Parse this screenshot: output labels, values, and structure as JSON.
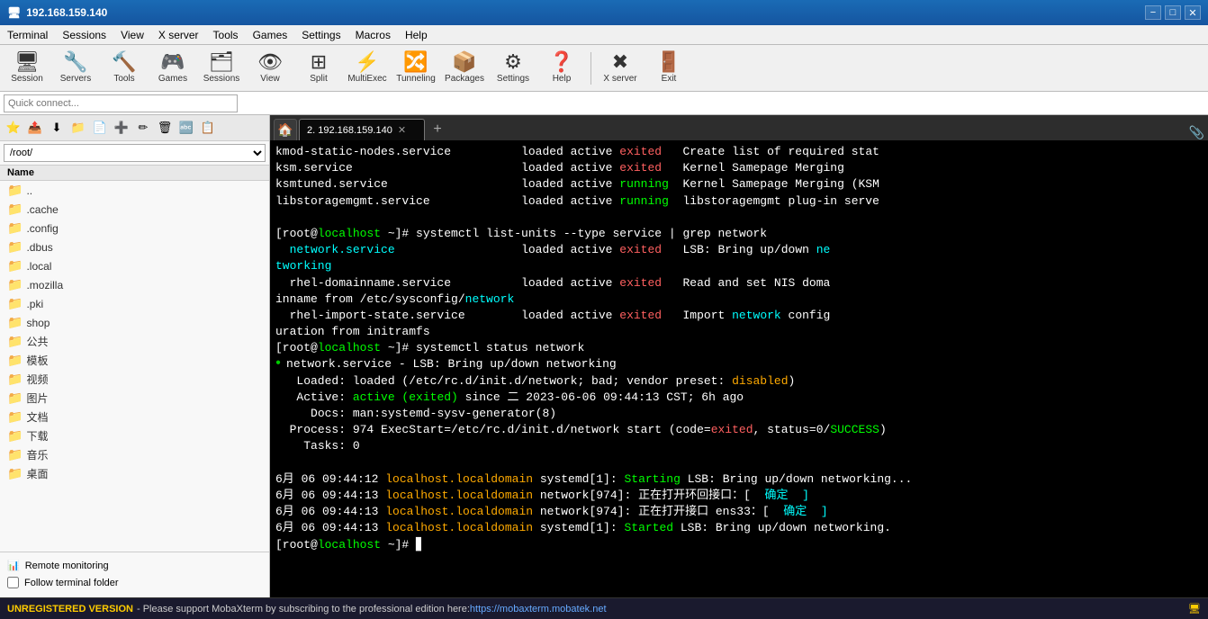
{
  "window": {
    "title": "192.168.159.140",
    "title_icon": "🖥",
    "controls": {
      "minimize": "−",
      "maximize": "□",
      "close": "✕"
    }
  },
  "menu": {
    "items": [
      "Terminal",
      "Sessions",
      "View",
      "X server",
      "Tools",
      "Games",
      "Settings",
      "Macros",
      "Help"
    ]
  },
  "toolbar": {
    "buttons": [
      {
        "label": "Session",
        "icon": "🖥"
      },
      {
        "label": "Servers",
        "icon": "🔧"
      },
      {
        "label": "Tools",
        "icon": "🔨"
      },
      {
        "label": "Games",
        "icon": "🎮"
      },
      {
        "label": "Sessions",
        "icon": "🗂"
      },
      {
        "label": "View",
        "icon": "👁"
      },
      {
        "label": "Split",
        "icon": "⊞"
      },
      {
        "label": "MultiExec",
        "icon": "⚡"
      },
      {
        "label": "Tunneling",
        "icon": "🔀"
      },
      {
        "label": "Packages",
        "icon": "📦"
      },
      {
        "label": "Settings",
        "icon": "⚙"
      },
      {
        "label": "Help",
        "icon": "❓"
      },
      {
        "label": "X server",
        "icon": "✖"
      },
      {
        "label": "Exit",
        "icon": "🚪"
      }
    ]
  },
  "quick_connect": {
    "placeholder": "Quick connect..."
  },
  "sidebar": {
    "toolbar_buttons": [
      "⭐",
      "📤",
      "⬇",
      "📁",
      "📄",
      "➕",
      "✏",
      "🗑",
      "🔤",
      "📋"
    ],
    "path": "/root/",
    "path_options": [
      "/root/"
    ],
    "column_header": "Name",
    "files": [
      {
        "name": "..",
        "type": "folder",
        "icon": "📁"
      },
      {
        "name": ".cache",
        "type": "folder",
        "icon": "📁"
      },
      {
        "name": ".config",
        "type": "folder",
        "icon": "📁"
      },
      {
        "name": ".dbus",
        "type": "folder",
        "icon": "📁"
      },
      {
        "name": ".local",
        "type": "folder",
        "icon": "📁"
      },
      {
        "name": ".mozilla",
        "type": "folder",
        "icon": "📁"
      },
      {
        "name": ".pki",
        "type": "folder",
        "icon": "📁"
      },
      {
        "name": "shop",
        "type": "folder",
        "icon": "📁"
      },
      {
        "name": "公共",
        "type": "folder",
        "icon": "📁"
      },
      {
        "name": "模板",
        "type": "folder",
        "icon": "📁"
      },
      {
        "name": "视频",
        "type": "folder",
        "icon": "📁"
      },
      {
        "name": "图片",
        "type": "folder",
        "icon": "📁"
      },
      {
        "name": "文档",
        "type": "folder",
        "icon": "📁"
      },
      {
        "name": "下载",
        "type": "folder",
        "icon": "📁"
      },
      {
        "name": "音乐",
        "type": "folder",
        "icon": "📁"
      },
      {
        "name": "桌面",
        "type": "folder",
        "icon": "📁"
      }
    ],
    "monitoring_label": "Remote monitoring",
    "monitoring_icon": "📊",
    "follow_label": "Follow terminal folder",
    "follow_checked": false
  },
  "tabs": {
    "home_icon": "🏠",
    "items": [
      {
        "label": "2. 192.168.159.140",
        "active": true,
        "has_close": true
      }
    ],
    "add_icon": "+",
    "right_icon": "📎"
  },
  "terminal": {
    "lines": [
      {
        "text": "kmod-static-nodes.service          loaded active exited   Create list of required stat",
        "parts": [
          {
            "text": "kmod-static-nodes.service          loaded active ",
            "color": "white"
          },
          {
            "text": "exited",
            "color": "red"
          },
          {
            "text": "   Create list of required stat",
            "color": "white"
          }
        ]
      },
      {
        "text": "ksm.service                        loaded active exited   Kernel Samepage Merging",
        "parts": [
          {
            "text": "ksm.service                        loaded active ",
            "color": "white"
          },
          {
            "text": "exited",
            "color": "red"
          },
          {
            "text": "   Kernel Samepage Merging",
            "color": "white"
          }
        ]
      },
      {
        "text": "ksmtuned.service                   loaded active running  Kernel Samepage Merging (KSM",
        "parts": [
          {
            "text": "ksmtuned.service                   loaded active ",
            "color": "white"
          },
          {
            "text": "running",
            "color": "green"
          },
          {
            "text": "  Kernel Samepage Merging (KSM",
            "color": "white"
          }
        ]
      },
      {
        "text": "libstoragemgmt.service             loaded active running  libstoragemgmt plug-in serve",
        "parts": [
          {
            "text": "libstoragemgmt.service             loaded active ",
            "color": "white"
          },
          {
            "text": "running",
            "color": "green"
          },
          {
            "text": "  libstoragemgmt plug-in serve",
            "color": "white"
          }
        ]
      },
      {
        "text": "",
        "parts": []
      },
      {
        "text": "[root@localhost ~]# systemctl list-units --type service | grep network",
        "parts": [
          {
            "text": "[root@",
            "color": "white"
          },
          {
            "text": "localhost",
            "color": "green"
          },
          {
            "text": " ~]# systemctl list-units --type service | grep network",
            "color": "white"
          }
        ]
      },
      {
        "text": "  network.service                  loaded active exited   LSB: Bring up/down ne",
        "parts": [
          {
            "text": "  ",
            "color": "white"
          },
          {
            "text": "network.service",
            "color": "cyan"
          },
          {
            "text": "                  loaded active ",
            "color": "white"
          },
          {
            "text": "exited",
            "color": "red"
          },
          {
            "text": "   LSB: Bring up/down ",
            "color": "white"
          },
          {
            "text": "ne",
            "color": "cyan"
          }
        ]
      },
      {
        "text": "tworking",
        "parts": [
          {
            "text": "tworking",
            "color": "cyan"
          }
        ]
      },
      {
        "text": "  rhel-domainname.service          loaded active exited   Read and set NIS doma",
        "parts": [
          {
            "text": "  rhel-domainname.service          loaded active ",
            "color": "white"
          },
          {
            "text": "exited",
            "color": "red"
          },
          {
            "text": "   Read and set NIS doma",
            "color": "white"
          }
        ]
      },
      {
        "text": "inname from /etc/sysconfig/network",
        "parts": [
          {
            "text": "inname from /etc/sysconfig/",
            "color": "white"
          },
          {
            "text": "network",
            "color": "cyan"
          }
        ]
      },
      {
        "text": "  rhel-import-state.service        loaded active exited   Import network config",
        "parts": [
          {
            "text": "  rhel-import-state.service        loaded active ",
            "color": "white"
          },
          {
            "text": "exited",
            "color": "red"
          },
          {
            "text": "   Import ",
            "color": "white"
          },
          {
            "text": "network",
            "color": "cyan"
          },
          {
            "text": " config",
            "color": "white"
          }
        ]
      },
      {
        "text": "uration from initramfs",
        "parts": [
          {
            "text": "uration from initramfs",
            "color": "white"
          }
        ]
      },
      {
        "text": "[root@localhost ~]# systemctl status network",
        "parts": [
          {
            "text": "[root@",
            "color": "white"
          },
          {
            "text": "localhost",
            "color": "green"
          },
          {
            "text": " ~]# systemctl status network",
            "color": "white"
          }
        ]
      },
      {
        "text": "● network.service - LSB: Bring up/down networking",
        "parts": [
          {
            "text": "● ",
            "color": "dot-green"
          },
          {
            "text": "network.service",
            "color": "white"
          },
          {
            "text": " - LSB: Bring up/down networking",
            "color": "white"
          }
        ]
      },
      {
        "text": "   Loaded: loaded (/etc/rc.d/init.d/network; bad; vendor preset: disabled)",
        "parts": [
          {
            "text": "   Loaded: loaded (/etc/rc.d/init.d/network; bad; vendor preset: ",
            "color": "white"
          },
          {
            "text": "disabled",
            "color": "orange"
          },
          {
            "text": ")",
            "color": "white"
          }
        ]
      },
      {
        "text": "   Active: active (exited) since 二 2023-06-06 09:44:13 CST; 6h ago",
        "parts": [
          {
            "text": "   Active: ",
            "color": "white"
          },
          {
            "text": "active (exited)",
            "color": "green"
          },
          {
            "text": " since 二 2023-06-06 09:44:13 CST; 6h ago",
            "color": "white"
          }
        ]
      },
      {
        "text": "     Docs: man:systemd-sysv-generator(8)",
        "parts": [
          {
            "text": "     Docs: man:systemd-sysv-generator(8)",
            "color": "white"
          }
        ]
      },
      {
        "text": "  Process: 974 ExecStart=/etc/rc.d/init.d/network start (code=exited, status=0/SUCCESS)",
        "parts": [
          {
            "text": "  Process: 974 ExecStart=/etc/rc.d/init.d/network start (code=",
            "color": "white"
          },
          {
            "text": "exited",
            "color": "red"
          },
          {
            "text": ", status=0/",
            "color": "white"
          },
          {
            "text": "SUCCESS",
            "color": "green"
          },
          {
            "text": ")",
            "color": "white"
          }
        ]
      },
      {
        "text": "    Tasks: 0",
        "parts": [
          {
            "text": "    Tasks: 0",
            "color": "white"
          }
        ]
      },
      {
        "text": "",
        "parts": []
      },
      {
        "text": "6月 06 09:44:12 localhost.localdomain systemd[1]: Starting LSB: Bring up/down networking...",
        "parts": [
          {
            "text": "6月 06 09:44:12 ",
            "color": "white"
          },
          {
            "text": "localhost.localdomain",
            "color": "orange"
          },
          {
            "text": " systemd[1]: ",
            "color": "white"
          },
          {
            "text": "Starting",
            "color": "green"
          },
          {
            "text": " LSB: Bring up/down networking...",
            "color": "white"
          }
        ]
      },
      {
        "text": "6月 06 09:44:13 localhost.localdomain network[974]: 正在打开环回接口：[  确定  ]",
        "parts": [
          {
            "text": "6月 06 09:44:13 ",
            "color": "white"
          },
          {
            "text": "localhost.localdomain",
            "color": "orange"
          },
          {
            "text": " network[974]: 正在打开环回接口：[  ",
            "color": "white"
          },
          {
            "text": "确定  ]",
            "color": "cyan"
          }
        ]
      },
      {
        "text": "6月 06 09:44:13 localhost.localdomain network[974]: 正在打开接口 ens33：[  确定  ]",
        "parts": [
          {
            "text": "6月 06 09:44:13 ",
            "color": "white"
          },
          {
            "text": "localhost.localdomain",
            "color": "orange"
          },
          {
            "text": " network[974]: 正在打开接口 ens33：[  ",
            "color": "white"
          },
          {
            "text": "确定  ]",
            "color": "cyan"
          }
        ]
      },
      {
        "text": "6月 06 09:44:13 localhost.localdomain systemd[1]: Started LSB: Bring up/down networking.",
        "parts": [
          {
            "text": "6月 06 09:44:13 ",
            "color": "white"
          },
          {
            "text": "localhost.localdomain",
            "color": "orange"
          },
          {
            "text": " systemd[1]: ",
            "color": "white"
          },
          {
            "text": "Started",
            "color": "green"
          },
          {
            "text": " LSB: Bring up/down networking.",
            "color": "white"
          }
        ]
      },
      {
        "text": "[root@localhost ~]# ▊",
        "parts": [
          {
            "text": "[root@",
            "color": "white"
          },
          {
            "text": "localhost",
            "color": "green"
          },
          {
            "text": " ~]# ",
            "color": "white"
          },
          {
            "text": "▊",
            "color": "white"
          }
        ]
      }
    ]
  },
  "status_bar": {
    "unregistered": "UNREGISTERED VERSION",
    "message": " -  Please support MobaXterm by subscribing to the professional edition here: ",
    "link": "https://mobaxterm.mobatek.net",
    "icon": "🖥"
  }
}
